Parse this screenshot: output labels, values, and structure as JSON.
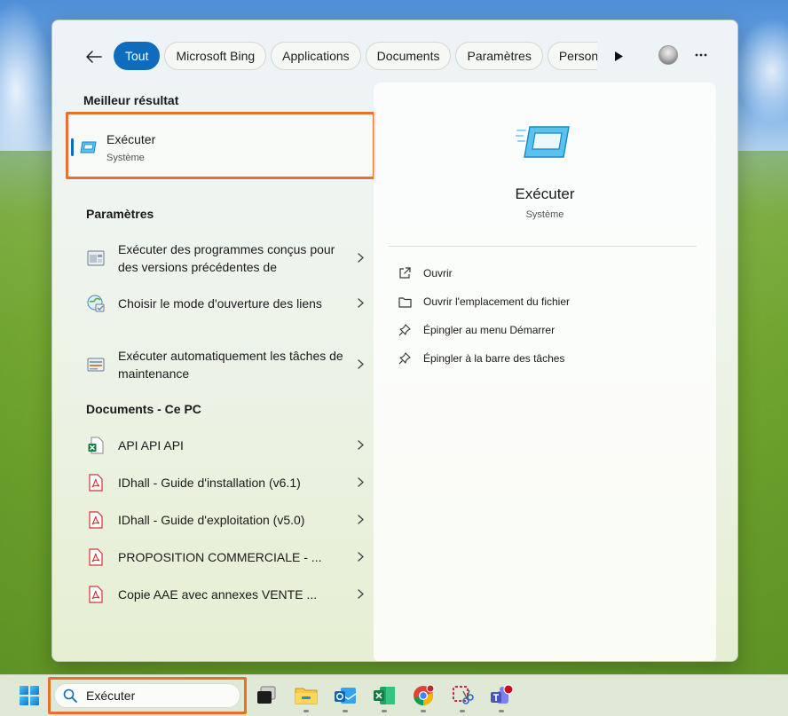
{
  "filter": {
    "chips": [
      "Tout",
      "Microsoft Bing",
      "Applications",
      "Documents",
      "Paramètres",
      "Personnes"
    ]
  },
  "left": {
    "best_header": "Meilleur résultat",
    "best": {
      "title": "Exécuter",
      "subtitle": "Système"
    },
    "settings_header": "Paramètres",
    "settings": [
      {
        "label": "Exécuter des programmes conçus pour des versions précédentes de",
        "icon": "compat-settings-icon"
      },
      {
        "label": "Choisir le mode d'ouverture des liens",
        "icon": "default-apps-icon"
      },
      {
        "label": "Exécuter automatiquement les tâches de maintenance",
        "icon": "maintenance-icon"
      }
    ],
    "docs_header": "Documents - Ce PC",
    "documents": [
      {
        "label": "API API API",
        "icon": "excel-file-icon"
      },
      {
        "label": "IDhall - Guide d'installation (v6.1)",
        "icon": "pdf-file-icon"
      },
      {
        "label": "IDhall - Guide d'exploitation (v5.0)",
        "icon": "pdf-file-icon"
      },
      {
        "label": "PROPOSITION COMMERCIALE - ...",
        "icon": "pdf-file-icon"
      },
      {
        "label": "Copie AAE avec annexes VENTE ...",
        "icon": "pdf-file-icon"
      }
    ]
  },
  "right": {
    "title": "Exécuter",
    "subtitle": "Système",
    "actions": [
      {
        "label": "Ouvrir",
        "icon": "open-icon"
      },
      {
        "label": "Ouvrir l'emplacement du fichier",
        "icon": "folder-icon"
      },
      {
        "label": "Épingler au menu Démarrer",
        "icon": "pin-icon"
      },
      {
        "label": "Épingler à la barre des tâches",
        "icon": "pin-icon"
      }
    ]
  },
  "taskbar": {
    "search_value": "Exécuter",
    "apps": [
      "task-view-icon",
      "file-explorer-icon",
      "outlook-icon",
      "excel-icon",
      "chrome-icon",
      "snipping-tool-icon",
      "teams-icon"
    ]
  },
  "colors": {
    "accent": "#0f6cbd",
    "highlight": "#e8702a"
  }
}
